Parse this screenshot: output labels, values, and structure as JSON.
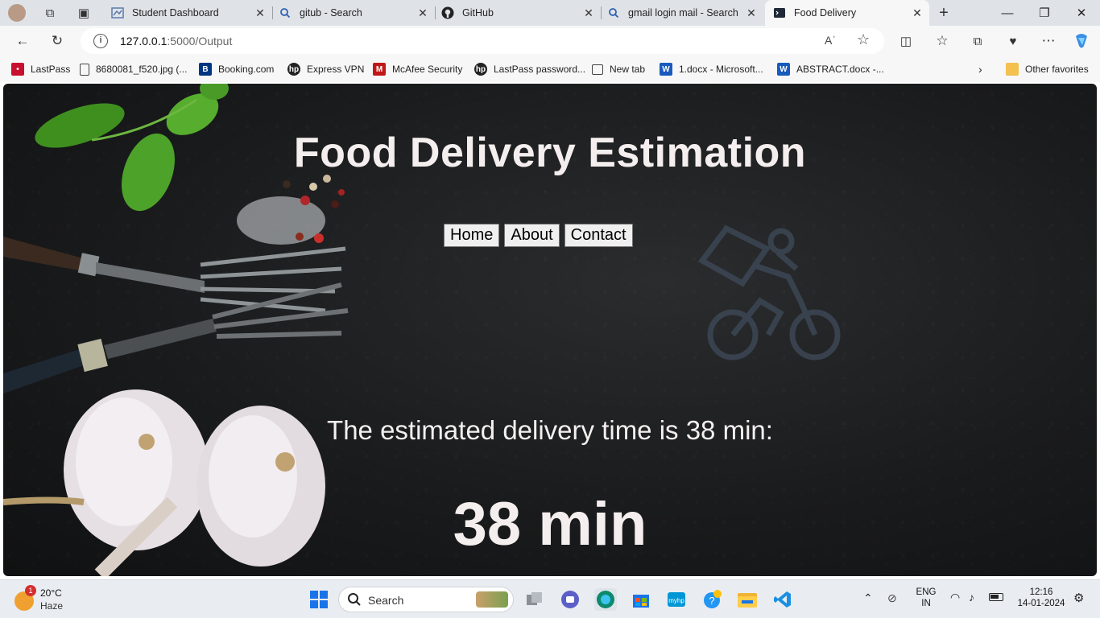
{
  "tabs": [
    {
      "title": "Student Dashboard",
      "icon": "dashboard-icon"
    },
    {
      "title": "gitub - Search",
      "icon": "search-icon"
    },
    {
      "title": "GitHub",
      "icon": "github-icon"
    },
    {
      "title": "gmail login mail - Search",
      "icon": "search-icon"
    },
    {
      "title": "Food Delivery",
      "icon": "terminal-icon",
      "active": true
    }
  ],
  "address": {
    "host": "127.0.0.1",
    "path": ":5000/Output"
  },
  "favorites": [
    {
      "label": "LastPass",
      "color": "#c8102e"
    },
    {
      "label": "8680081_f520.jpg (...",
      "color": "#ffffff"
    },
    {
      "label": "Booking.com",
      "color": "#003580"
    },
    {
      "label": "Express VPN",
      "color": "#222222"
    },
    {
      "label": "McAfee Security",
      "color": "#c01818"
    },
    {
      "label": "LastPass password...",
      "color": "#222222"
    },
    {
      "label": "New tab",
      "color": "#ffffff"
    },
    {
      "label": "1.docx - Microsoft...",
      "color": "#185abd"
    },
    {
      "label": "ABSTRACT.docx -...",
      "color": "#185abd"
    }
  ],
  "other_favorites": "Other favorites",
  "page": {
    "title": "Food Delivery Estimation",
    "nav": [
      "Home",
      "About",
      "Contact"
    ],
    "result_text": "The estimated delivery time is 38 min:",
    "result_value": "38 min"
  },
  "taskbar": {
    "weather_temp": "20°C",
    "weather_desc": "Haze",
    "weather_badge": "1",
    "search_label": "Search",
    "lang": "ENG",
    "region": "IN",
    "time": "12:16",
    "date": "14-01-2024"
  }
}
